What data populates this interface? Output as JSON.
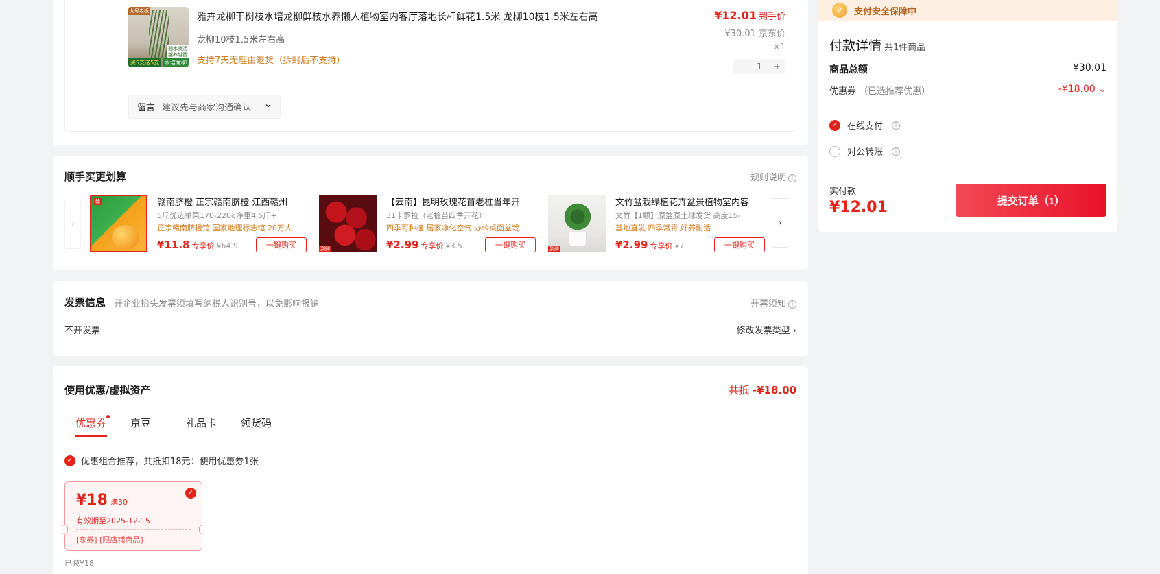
{
  "product": {
    "title": "雅卉龙柳干树枝水培龙柳鲜枝水养懒人植物室内客厅落地长杆鲜花1.5米 龙柳10枝1.5米左右高",
    "spec": "龙柳10枝1.5米左右高",
    "return_policy": "支持7天无理由退货（拆封后不支持）",
    "price": "¥12.01",
    "price_label": "到手价",
    "jd_price": "¥30.01",
    "jd_price_label": "京东价",
    "qty_x": "×1",
    "qty": "1",
    "qty_minus": "-",
    "qty_plus": "+",
    "img_tags": {
      "top_left": "九号老板",
      "right_mid": "適水就活\n越养越香",
      "green": "水培龙柳",
      "bottom": "买5支送5支"
    }
  },
  "remark": {
    "label": "留言",
    "value": "建议先与商家沟通确认"
  },
  "buy_more": {
    "title": "顺手买更划算",
    "rule": "规则说明",
    "items": [
      {
        "name": "赣南脐橙 正宗赣南脐橙 江西赣州",
        "sub": "5斤优选单果170-220g净重4.5斤+",
        "tags": "正宗赣南脐橙馆 国家地理标志馆 20万人",
        "price": "¥11.8",
        "exclusive": "专享价",
        "orig": "¥64.9",
        "btn": "一键购买"
      },
      {
        "name": "【云南】昆明玫瑰花苗老桩当年开",
        "sub": "31卡罗拉（老桩苗四季开花）",
        "tags": "四季可种植 居家净化空气 办公桌面盆栽",
        "price": "¥2.99",
        "exclusive": "专享价",
        "orig": "¥3.5",
        "btn": "一键购买",
        "mini_tag": "到鲜"
      },
      {
        "name": "文竹盆栽绿植花卉盆景植物室内客",
        "sub": "文竹【1颗】原盆原土球发货 高度15-",
        "tags": "基地直发 四季常青 好养耐活",
        "price": "¥2.99",
        "exclusive": "专享价",
        "orig": "¥7",
        "btn": "一键购买",
        "mini_tag": "到鲜"
      }
    ]
  },
  "invoice": {
    "title": "发票信息",
    "tip": "开企业抬头发票须填写纳税人识别号，以免影响报销",
    "notice": "开票须知",
    "value": "不开发票",
    "modify": "修改发票类型 ›"
  },
  "coupons": {
    "title": "使用优惠/虚拟资产",
    "total_label": "共抵",
    "total_value": "-¥18.00",
    "tabs": [
      "优惠券",
      "京豆",
      "礼品卡",
      "领货码"
    ],
    "combo": "优惠组合推荐，共抵扣18元：使用优惠券1张",
    "coupon": {
      "amount": "¥18",
      "threshold": "满30",
      "expiry": "有效期至2025-12-15",
      "scope": "[东券] [限店铺商品]"
    },
    "reduced": "已减¥18"
  },
  "payment": {
    "safe": "支付安全保障中",
    "title": "付款详情",
    "count": "共1件商品",
    "goods_total_label": "商品总额",
    "goods_total": "¥30.01",
    "coupon_label": "优惠券",
    "coupon_note": "（已选推荐优惠）",
    "coupon_value": "-¥18.00 ⌄",
    "options": [
      "在线支付",
      "对公转账"
    ],
    "actual_label": "实付款",
    "actual_value": "¥12.01",
    "submit": "提交订单（1）"
  },
  "colors": {
    "accent": "#e2231a",
    "warning": "#d07a1b",
    "bg": "#f2f3f5"
  }
}
